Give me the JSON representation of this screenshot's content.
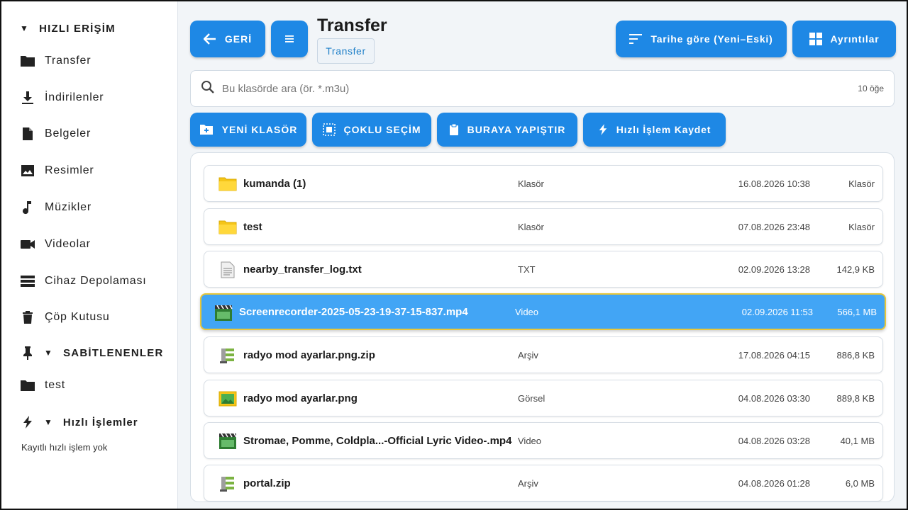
{
  "sidebar": {
    "quick_access_title": "HIZLI ERİŞİM",
    "items": [
      {
        "label": "Transfer",
        "icon": "folder-icon"
      },
      {
        "label": "İndirilenler",
        "icon": "download-icon"
      },
      {
        "label": "Belgeler",
        "icon": "document-icon"
      },
      {
        "label": "Resimler",
        "icon": "image-icon"
      },
      {
        "label": "Müzikler",
        "icon": "music-icon"
      },
      {
        "label": "Videolar",
        "icon": "video-camera-icon"
      },
      {
        "label": "Cihaz Depolaması",
        "icon": "storage-icon"
      },
      {
        "label": "Çöp Kutusu",
        "icon": "trash-icon"
      }
    ],
    "pinned_title": "SABİTLENENLER",
    "pinned_items": [
      {
        "label": "test",
        "icon": "folder-icon"
      }
    ],
    "quick_actions_title": "Hızlı İşlemler",
    "quick_actions_empty": "Kayıtlı hızlı işlem yok"
  },
  "header": {
    "back_label": "GERİ",
    "menu_icon": "hamburger-icon",
    "title": "Transfer",
    "breadcrumb": "Transfer",
    "sort_label": "Tarihe göre (Yeni–Eski)",
    "details_label": "Ayrıntılar"
  },
  "search": {
    "placeholder": "Bu klasörde ara (ör. *.m3u)",
    "value": "",
    "count": "10 öğe"
  },
  "actions": {
    "new_folder": "YENİ KLASÖR",
    "multi_select": "ÇOKLU SEÇİM",
    "paste_here": "BURAYA YAPIŞTIR",
    "save_quick_action": "Hızlı İşlem Kaydet"
  },
  "files": [
    {
      "name": "kumanda (1)",
      "type": "Klasör",
      "date": "16.08.2026 10:38",
      "size": "Klasör",
      "icon": "folder-icon"
    },
    {
      "name": "test",
      "type": "Klasör",
      "date": "07.08.2026 23:48",
      "size": "Klasör",
      "icon": "folder-icon"
    },
    {
      "name": "nearby_transfer_log.txt",
      "type": "TXT",
      "date": "02.09.2026 13:28",
      "size": "142,9 KB",
      "icon": "text-file-icon"
    },
    {
      "name": "Screenrecorder-2025-05-23-19-37-15-837.mp4",
      "type": "Video",
      "date": "02.09.2026 11:53",
      "size": "566,1 MB",
      "icon": "video-file-icon",
      "selected": true
    },
    {
      "name": "radyo mod ayarlar.png.zip",
      "type": "Arşiv",
      "date": "17.08.2026 04:15",
      "size": "886,8 KB",
      "icon": "archive-icon"
    },
    {
      "name": "radyo mod ayarlar.png",
      "type": "Görsel",
      "date": "04.08.2026 03:30",
      "size": "889,8 KB",
      "icon": "image-file-icon"
    },
    {
      "name": "Stromae, Pomme, Coldpla...-Official Lyric Video-.mp4",
      "type": "Video",
      "date": "04.08.2026 03:28",
      "size": "40,1 MB",
      "icon": "video-file-icon"
    },
    {
      "name": "portal.zip",
      "type": "Arşiv",
      "date": "04.08.2026 01:28",
      "size": "6,0 MB",
      "icon": "archive-icon"
    }
  ],
  "colors": {
    "accent": "#1e88e5",
    "selected_row": "#42a5f5",
    "selected_border": "#e7c73a",
    "background": "#f2f5f8"
  }
}
